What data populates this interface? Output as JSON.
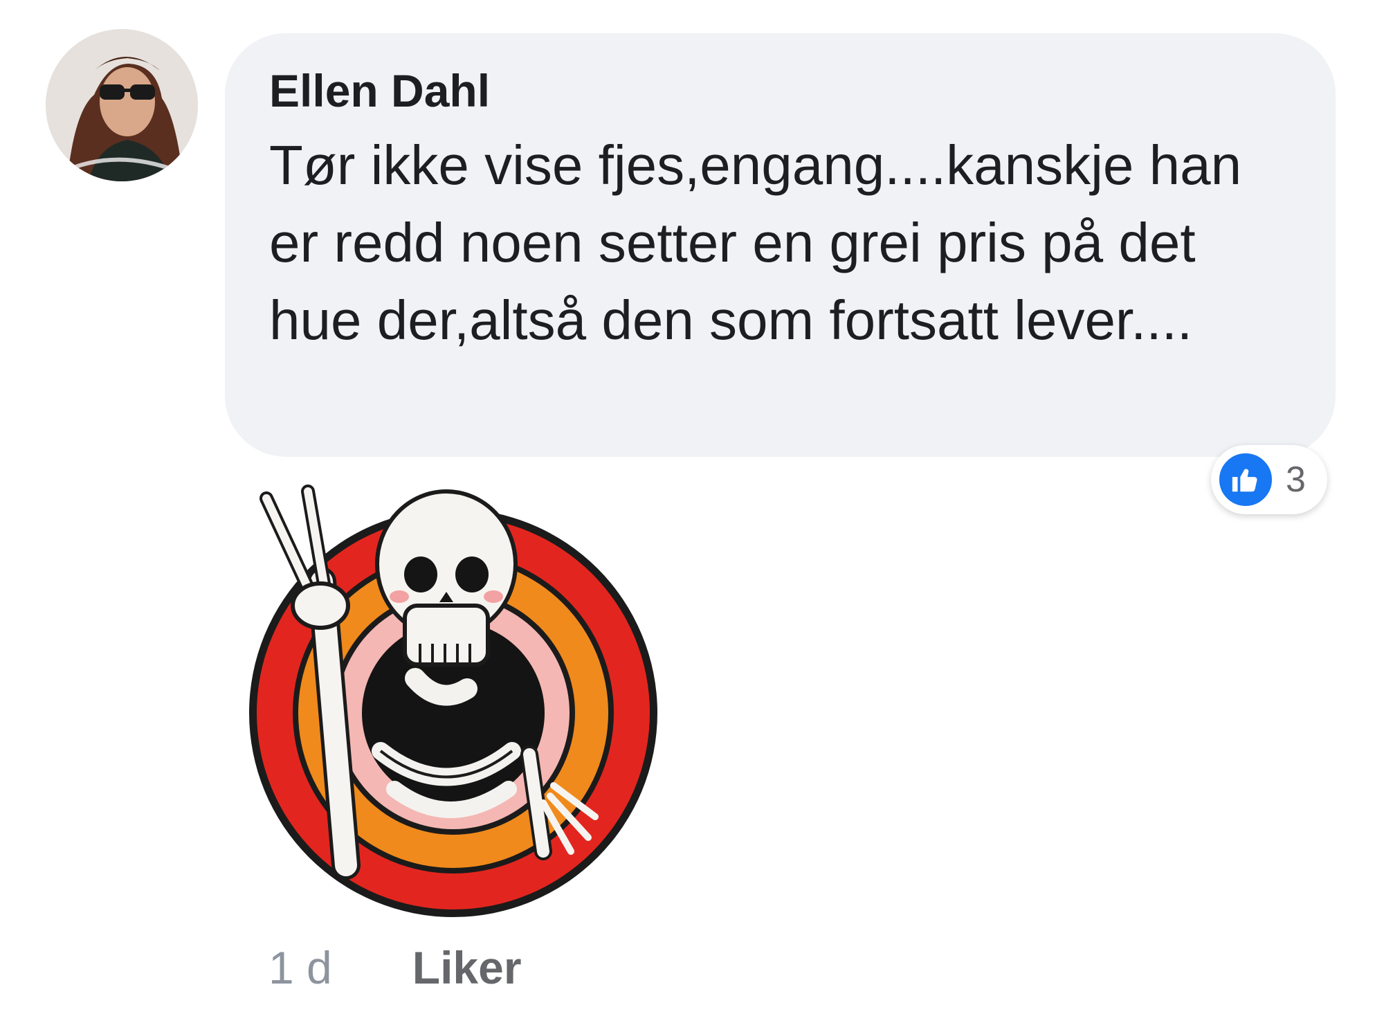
{
  "comment": {
    "author": "Ellen Dahl",
    "text": "Tør ikke vise fjes,engang....kanskje han er redd noen setter en grei pris på det hue der,altså den som fortsatt lever....",
    "reaction_count": "3",
    "timestamp": "1 d",
    "like_label": "Liker",
    "avatar_icon": "profile-photo",
    "sticker_icon": "skeleton-peace-sign-sticker"
  },
  "colors": {
    "bubble": "#f0f2f5",
    "like_blue": "#1877f2",
    "meta_text": "#8d949e"
  }
}
